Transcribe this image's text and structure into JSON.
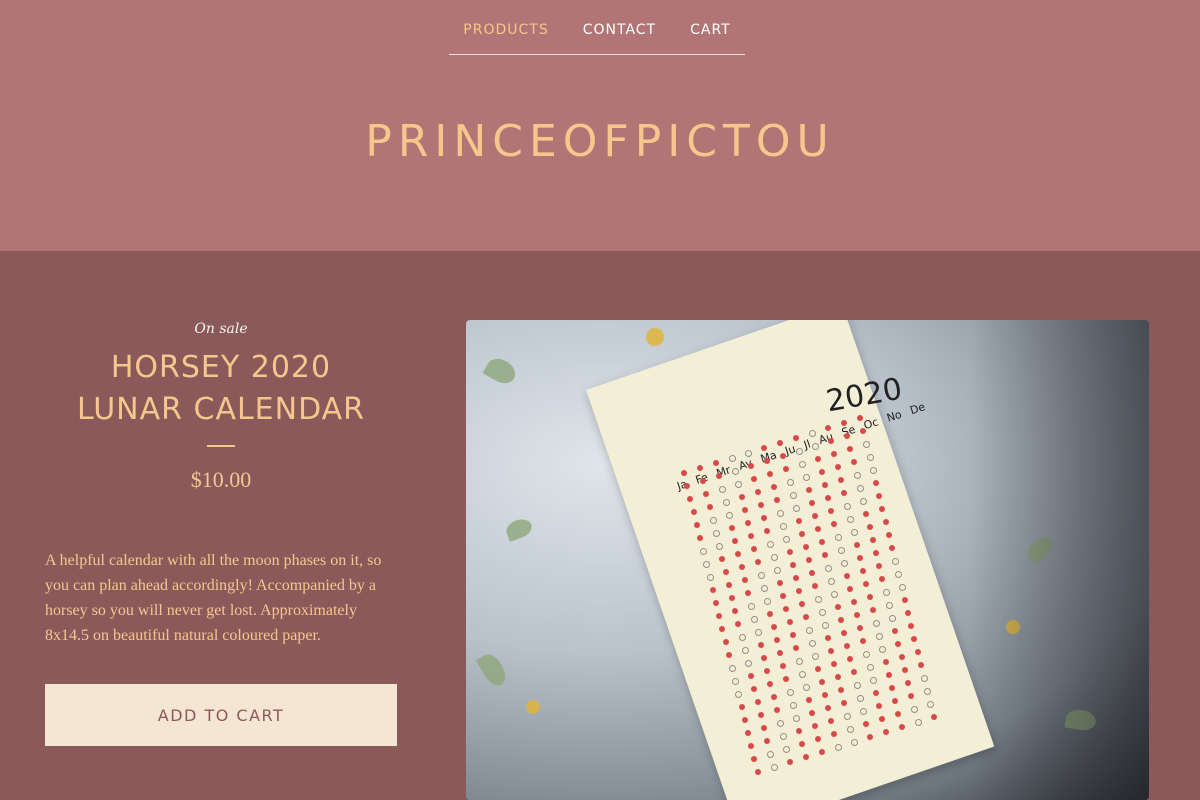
{
  "nav": {
    "items": [
      {
        "label": "PRODUCTS"
      },
      {
        "label": "CONTACT"
      },
      {
        "label": "CART"
      }
    ]
  },
  "site": {
    "title": "PRINCEOFPICTOU"
  },
  "product": {
    "badge": "On sale",
    "title_line1": "HORSEY 2020",
    "title_line2": "LUNAR CALENDAR",
    "price": "$10.00",
    "description": "A helpful calendar with all the moon phases on it, so you can plan ahead accordingly! Accompanied by a horsey so you will never get lost. Approximately 8x14.5 on beautiful natural coloured paper.",
    "add_button": "ADD TO CART"
  },
  "image": {
    "calendar_year": "2020",
    "months": "Ja Fe Mr Av Ma Ju Jl Au Se Oc No De"
  },
  "colors": {
    "header_bg": "#b07574",
    "body_bg": "#8a5a5b",
    "accent": "#f6c78d",
    "button_bg": "#f5e6d3"
  }
}
